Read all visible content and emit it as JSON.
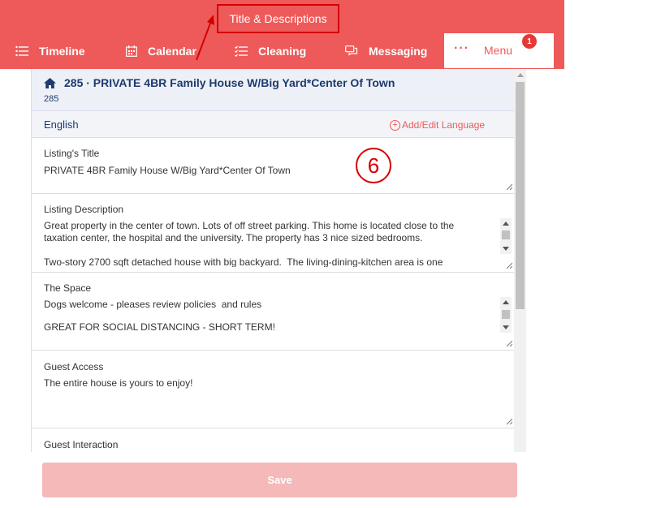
{
  "header": {
    "title_tab": "Title & Descriptions",
    "nav": [
      {
        "label": "Timeline",
        "icon": "list-icon"
      },
      {
        "label": "Calendar",
        "icon": "calendar-icon"
      },
      {
        "label": "Cleaning",
        "icon": "checklist-icon"
      },
      {
        "label": "Messaging",
        "icon": "chat-icon"
      }
    ],
    "menu": {
      "dots": "···",
      "label": "Menu",
      "badge": "1"
    },
    "colors": {
      "brand": "#ee5a5a",
      "annotation": "#d40000"
    }
  },
  "listing": {
    "title": "285 · PRIVATE 4BR Family House W/Big Yard*Center Of Town",
    "id": "285"
  },
  "language": {
    "current": "English",
    "add_edit_label": "Add/Edit Language"
  },
  "fields": {
    "title": {
      "label": "Listing's Title",
      "value": "PRIVATE 4BR Family House W/Big Yard*Center Of Town"
    },
    "description": {
      "label": "Listing Description",
      "value": "Great property in the center of town. Lots of off street parking. This home is located close to the taxation center, the hospital and the university. The property has 3 nice sized bedrooms.\n\nTwo-story 2700 sqft detached house with big backyard.  The living-dining-kitchen area is one"
    },
    "space": {
      "label": "The Space",
      "value": "Dogs welcome - pleases review policies  and rules\n\nGREAT FOR SOCIAL DISTANCING - SHORT TERM!"
    },
    "guest_access": {
      "label": "Guest Access",
      "value": "The entire house is yours to enjoy!"
    },
    "guest_interaction": {
      "label": "Guest Interaction"
    }
  },
  "annotation": {
    "step": "6"
  },
  "actions": {
    "save_label": "Save"
  }
}
